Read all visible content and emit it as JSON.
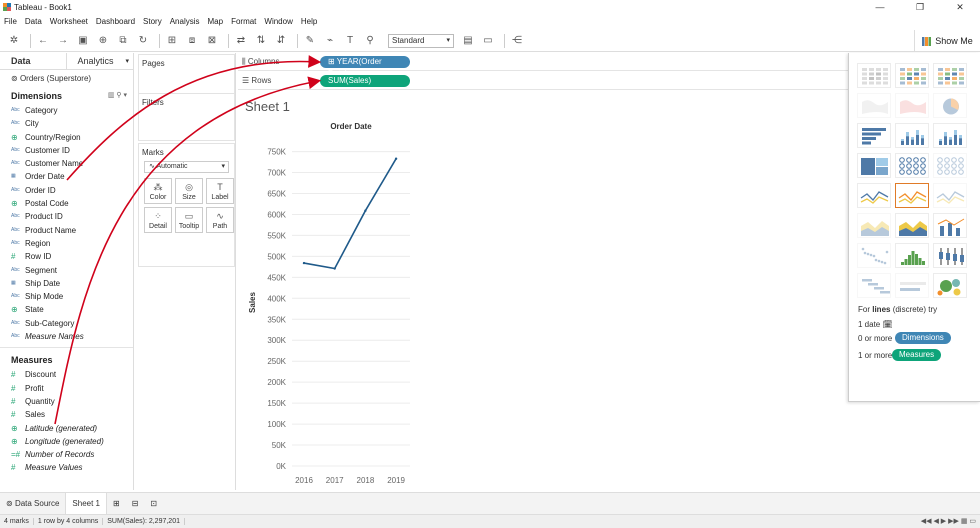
{
  "window": {
    "title": "Tableau - Book1",
    "controls": [
      "—",
      "❐",
      "✕"
    ]
  },
  "menu": [
    "File",
    "Data",
    "Worksheet",
    "Dashboard",
    "Story",
    "Analysis",
    "Map",
    "Format",
    "Window",
    "Help"
  ],
  "toolbar": {
    "fit_select": "Standard",
    "show_me": "Show Me"
  },
  "data_pane": {
    "tabs": [
      "Data",
      "Analytics"
    ],
    "datasource": "Orders (Superstore)",
    "dimensions_label": "Dimensions",
    "dimensions": [
      {
        "type": "Abc",
        "name": "Category"
      },
      {
        "type": "Abc",
        "name": "City"
      },
      {
        "type": "geo",
        "name": "Country/Region"
      },
      {
        "type": "Abc",
        "name": "Customer ID"
      },
      {
        "type": "Abc",
        "name": "Customer Name"
      },
      {
        "type": "date",
        "name": "Order Date"
      },
      {
        "type": "Abc",
        "name": "Order ID"
      },
      {
        "type": "geo",
        "name": "Postal Code"
      },
      {
        "type": "Abc",
        "name": "Product ID"
      },
      {
        "type": "Abc",
        "name": "Product Name"
      },
      {
        "type": "Abc",
        "name": "Region"
      },
      {
        "type": "#",
        "name": "Row ID"
      },
      {
        "type": "Abc",
        "name": "Segment"
      },
      {
        "type": "date",
        "name": "Ship Date"
      },
      {
        "type": "Abc",
        "name": "Ship Mode"
      },
      {
        "type": "geo",
        "name": "State"
      },
      {
        "type": "Abc",
        "name": "Sub-Category"
      },
      {
        "type": "Abc",
        "name": "Measure Names",
        "italic": true
      }
    ],
    "measures_label": "Measures",
    "measures": [
      {
        "type": "#",
        "name": "Discount"
      },
      {
        "type": "#",
        "name": "Profit"
      },
      {
        "type": "#",
        "name": "Quantity"
      },
      {
        "type": "#",
        "name": "Sales"
      },
      {
        "type": "geo",
        "name": "Latitude (generated)",
        "italic": true
      },
      {
        "type": "geo",
        "name": "Longitude (generated)",
        "italic": true
      },
      {
        "type": "=#",
        "name": "Number of Records",
        "italic": true
      },
      {
        "type": "#",
        "name": "Measure Values",
        "italic": true
      }
    ]
  },
  "cards": {
    "pages": "Pages",
    "filters": "Filters",
    "marks": "Marks",
    "mark_type": "Automatic",
    "mark_buttons": [
      {
        "icon": "⁂",
        "label": "Color"
      },
      {
        "icon": "◎",
        "label": "Size"
      },
      {
        "icon": "T",
        "label": "Label"
      },
      {
        "icon": "⁘",
        "label": "Detail"
      },
      {
        "icon": "▭",
        "label": "Tooltip"
      },
      {
        "icon": "∿",
        "label": "Path"
      }
    ]
  },
  "shelves": {
    "columns_label": "Columns",
    "columns_pill": "YEAR(Order Date)",
    "rows_label": "Rows",
    "rows_pill": "SUM(Sales)"
  },
  "sheet": {
    "title": "Sheet 1"
  },
  "chart_data": {
    "type": "line",
    "title": "Order Date",
    "xlabel": "",
    "ylabel": "Sales",
    "categories": [
      "2016",
      "2017",
      "2018",
      "2019"
    ],
    "values": [
      484000,
      471000,
      609000,
      733000
    ],
    "ylim": [
      0,
      780000
    ],
    "yticks": [
      "0K",
      "50K",
      "100K",
      "150K",
      "200K",
      "250K",
      "300K",
      "350K",
      "400K",
      "450K",
      "500K",
      "550K",
      "600K",
      "650K",
      "700K",
      "750K"
    ],
    "color": "#1f5a8a",
    "grid": true
  },
  "show_me": {
    "hint_prefix": "For ",
    "hint_bold": "lines",
    "hint_suffix": " (discrete) try",
    "req1": "1 date",
    "req2": "0 or more",
    "req2_pill": "Dimensions",
    "req3": "1 or more",
    "req3_pill": "Measures",
    "colors": {
      "dimension": "#3f86b5",
      "measure": "#0ea47a",
      "selected": "#e07b28"
    }
  },
  "bottom": {
    "tabs": [
      "Data Source",
      "Sheet 1"
    ]
  },
  "status": {
    "marks": "4 marks",
    "layout": "1 row by 4 columns",
    "sum": "SUM(Sales): 2,297,201"
  }
}
